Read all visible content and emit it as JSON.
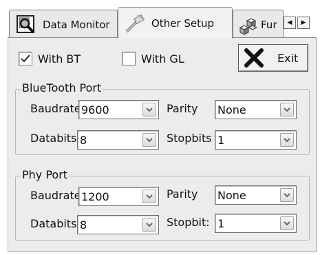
{
  "tabs": [
    {
      "label": "Data Monitor",
      "icon": "magnifier-icon"
    },
    {
      "label": "Other Setup",
      "icon": "satellite-icon"
    },
    {
      "label": "Fur",
      "icon": "blocks-icon"
    }
  ],
  "tab_scroll": {
    "left": "◀",
    "right": "▶"
  },
  "options": {
    "with_bt": {
      "label": "With BT",
      "checked": true
    },
    "with_gl": {
      "label": "With GL",
      "checked": false
    }
  },
  "exit_button": {
    "label": "Exit",
    "icon": "x-icon"
  },
  "bluetooth_port": {
    "title": "BlueTooth Port",
    "baudrate": {
      "label": "Baudrate",
      "value": "9600"
    },
    "parity": {
      "label": "Parity",
      "value": "None"
    },
    "databits": {
      "label": "Databits",
      "value": "8"
    },
    "stopbits": {
      "label": "Stopbits",
      "value": "1"
    }
  },
  "phy_port": {
    "title": "Phy Port",
    "baudrate": {
      "label": "Baudrate",
      "value": "1200"
    },
    "parity": {
      "label": "Parity",
      "value": "None"
    },
    "databits": {
      "label": "Databits",
      "value": "8"
    },
    "stopbits": {
      "label": "Stopbit:",
      "value": "1"
    }
  },
  "colors": {
    "panel": "#ececec",
    "border": "#7f7f7f",
    "check": "#3a3a3a",
    "exit_x": "#111111"
  }
}
